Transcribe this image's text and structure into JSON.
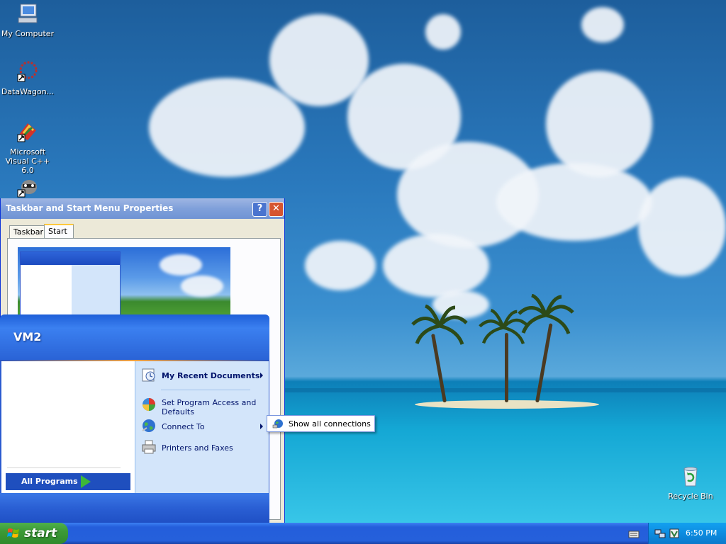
{
  "desktop": {
    "icons": [
      {
        "label": "My Computer"
      },
      {
        "label": "DataWagon..."
      },
      {
        "label": "Microsoft Visual C++ 6.0"
      },
      {
        "label": ""
      },
      {
        "label": "Recycle Bin"
      }
    ]
  },
  "properties_window": {
    "title": "Taskbar and Start Menu Properties",
    "help_button": "?",
    "close_button": "✕",
    "tabs": [
      {
        "label": "Taskbar",
        "active": false
      },
      {
        "label": "Start Menu",
        "active": true
      }
    ]
  },
  "start_menu": {
    "user_name": "VM2",
    "all_programs": "All Programs",
    "right_items": [
      {
        "label": "My Recent Documents",
        "bold": true,
        "has_submenu": true
      },
      {
        "label": "Set Program Access and Defaults",
        "bold": false,
        "has_submenu": false
      },
      {
        "label": "Connect To",
        "bold": false,
        "has_submenu": true
      },
      {
        "label": "Printers and Faxes",
        "bold": false,
        "has_submenu": false
      }
    ]
  },
  "connect_submenu": {
    "items": [
      {
        "label": "Show all connections"
      }
    ]
  },
  "taskbar": {
    "start_label": "start",
    "clock": "6:50 PM"
  }
}
